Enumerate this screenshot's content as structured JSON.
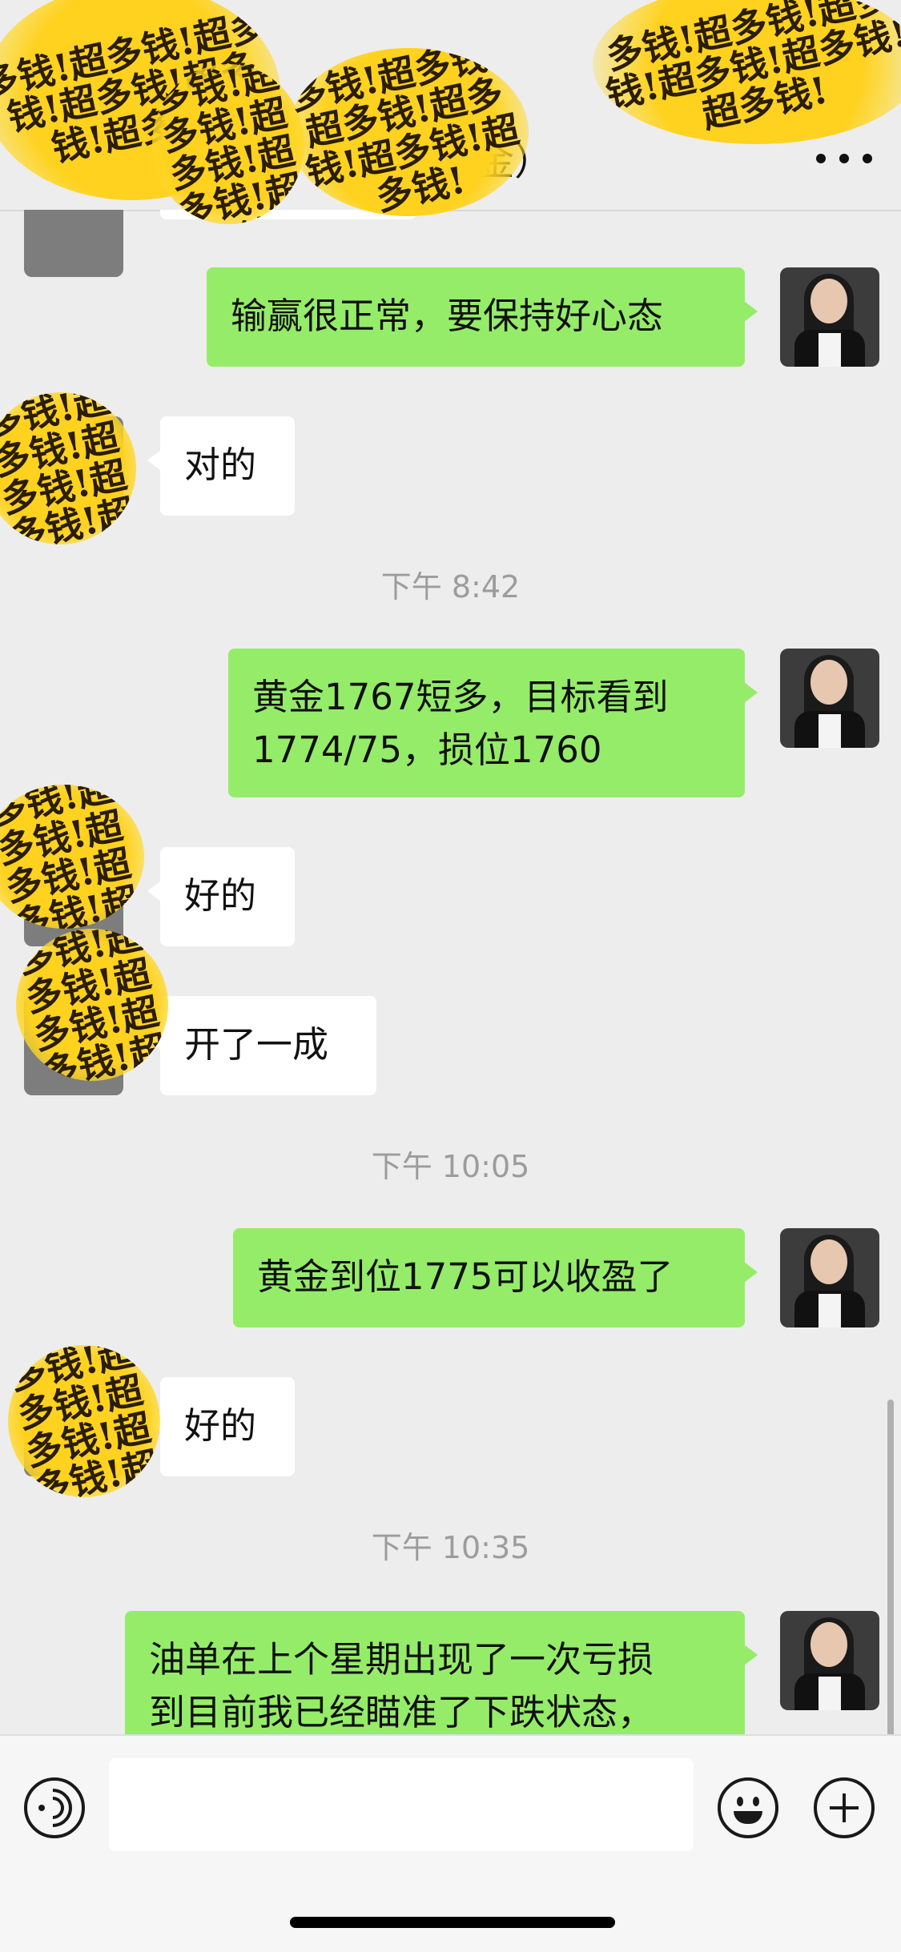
{
  "header": {
    "title": "女          万美金）",
    "more_icon": "more-icon"
  },
  "sticker_text": "多钱!超多钱!超多钱!超多钱!超多钱!超多钱!",
  "messages": [
    {
      "text": "输赢很正常，要保持好心态"
    },
    {
      "text": "对的"
    },
    {
      "text": "黄金1767短多，目标看到\n1774/75，损位1760"
    },
    {
      "text": "好的"
    },
    {
      "text": "开了一成"
    },
    {
      "text": "黄金到位1775可以收盈了"
    },
    {
      "text": "好的"
    },
    {
      "text": "油单在上个星期出现了一次亏损\n到目前我已经瞄准了下跌状态，"
    }
  ],
  "times": [
    "下午 8:42",
    "下午 10:05",
    "下午 10:35"
  ],
  "input": {
    "voice_icon": "voice-icon",
    "emoji_icon": "emoji-icon",
    "plus_icon": "plus-icon",
    "value": ""
  },
  "colors": {
    "self_bubble": "#95ec69",
    "other_bubble": "#ffffff",
    "background": "#ededed",
    "sticker": "#ffd21f"
  }
}
